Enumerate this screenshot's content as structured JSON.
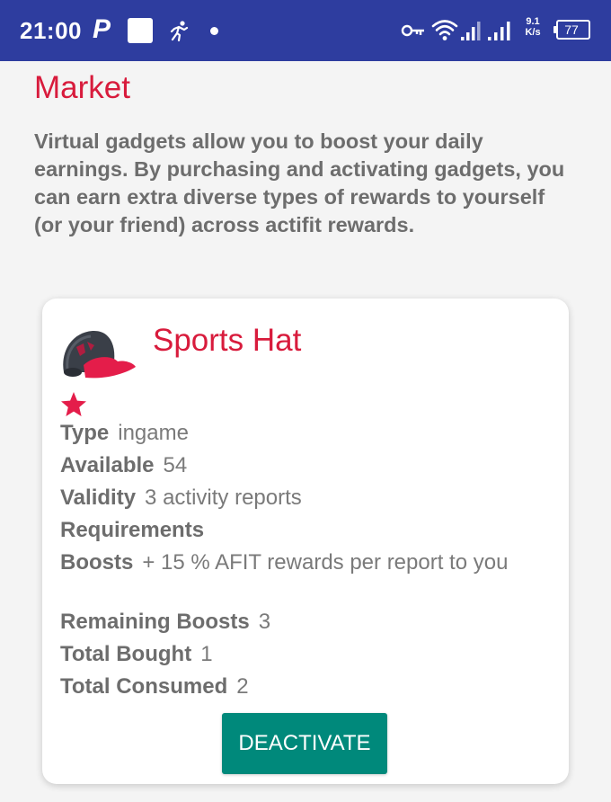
{
  "status_bar": {
    "time": "21:00",
    "p_glyph": "P",
    "speed_top": "9.1",
    "speed_bottom": "K/s",
    "battery": "77",
    "icons": [
      "square-icon",
      "running-icon",
      "dot-icon",
      "key-icon",
      "wifi-icon",
      "signal-icon",
      "signal-icon",
      "battery-icon"
    ]
  },
  "page": {
    "title": "Market",
    "intro": "Virtual gadgets allow you to boost your daily earnings. By purchasing and activating gadgets, you can earn extra diverse types of rewards to yourself (or your friend) across actifit rewards."
  },
  "gadget": {
    "name": "Sports Hat",
    "image_icon": "sports-hat-icon",
    "rating_icon": "star-icon",
    "fields": {
      "type_label": "Type",
      "type_value": "ingame",
      "available_label": "Available",
      "available_value": "54",
      "validity_label": "Validity",
      "validity_value": "3 activity reports",
      "requirements_label": "Requirements",
      "boosts_label": "Boosts",
      "boosts_value": "+ 15 % AFIT rewards per report to you",
      "remaining_label": "Remaining Boosts",
      "remaining_value": "3",
      "bought_label": "Total Bought",
      "bought_value": "1",
      "consumed_label": "Total Consumed",
      "consumed_value": "2"
    },
    "action_label": "DEACTIVATE"
  },
  "colors": {
    "status_bar": "#2e3d9f",
    "accent_red": "#d81b3c",
    "button_teal": "#00897b",
    "text_gray": "#6d6d6d"
  }
}
